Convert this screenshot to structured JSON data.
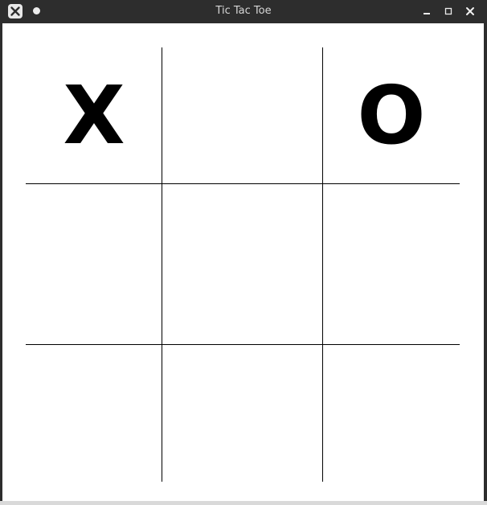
{
  "window": {
    "title": "Tic Tac Toe",
    "app_icon": "close-x-icon",
    "controls": [
      "minimize-icon",
      "maximize-icon",
      "close-icon"
    ]
  },
  "board": {
    "cells": [
      "X",
      "",
      "O",
      "",
      "",
      "",
      "",
      "",
      ""
    ]
  },
  "colors": {
    "titlebar": "#2d2d2d",
    "board_background": "#ffffff",
    "grid_lines": "#000000",
    "marks": "#000000"
  }
}
